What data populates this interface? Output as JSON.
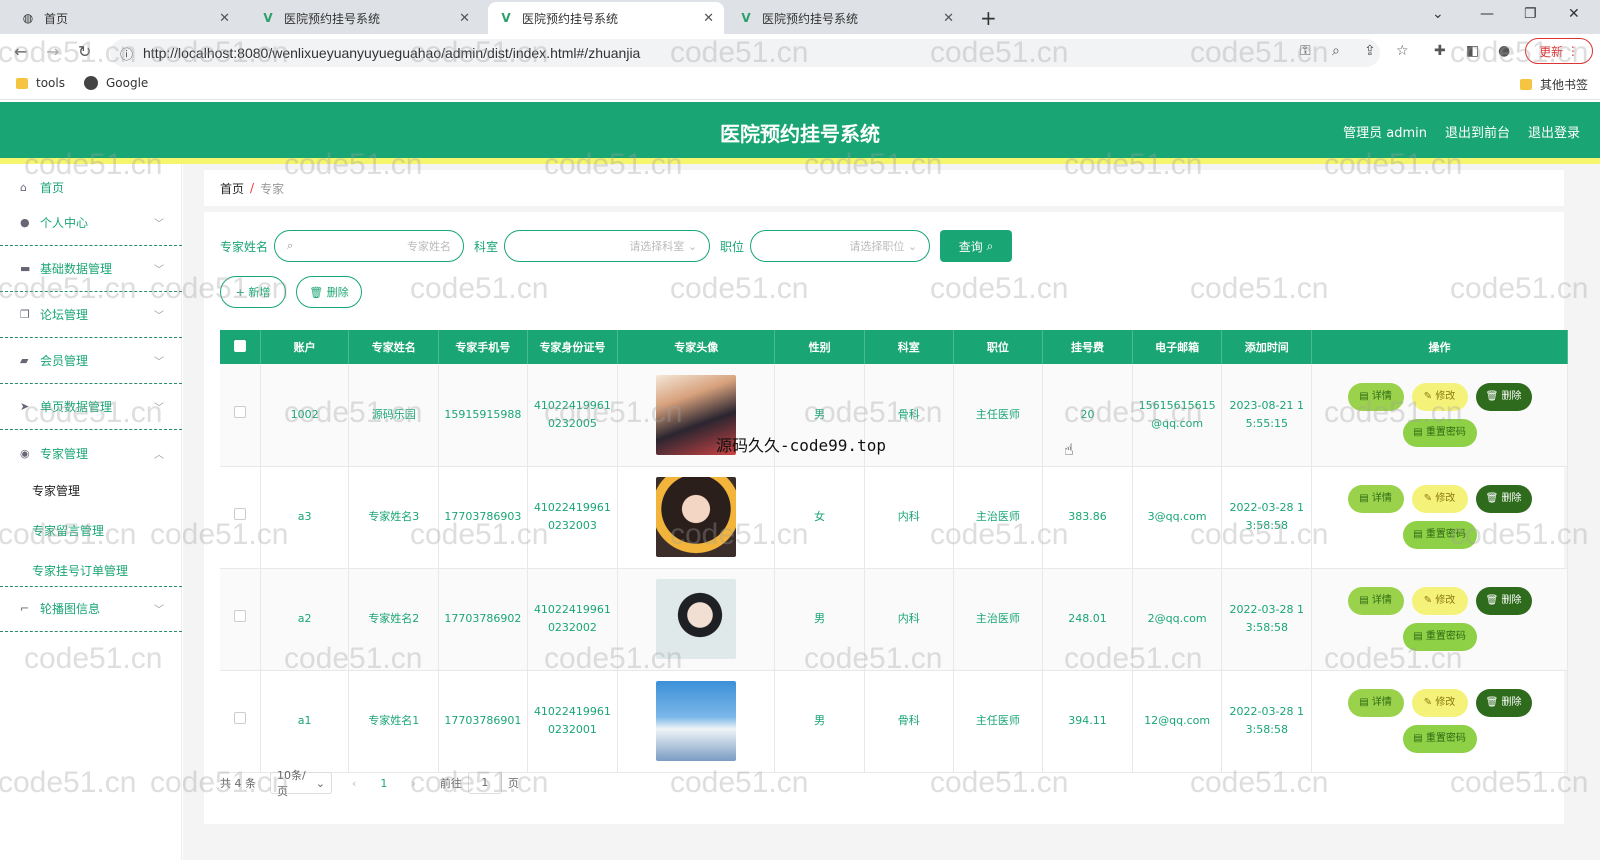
{
  "browser": {
    "tabs": [
      {
        "title": "首页",
        "icon": "globe-icon"
      },
      {
        "title": "医院预约挂号系统",
        "icon": "vue-icon"
      },
      {
        "title": "医院预约挂号系统",
        "icon": "vue-icon"
      },
      {
        "title": "医院预约挂号系统",
        "icon": "vue-icon"
      }
    ],
    "url": "http://localhost:8080/wenlixueyuanyuyueguahao/admin/dist/index.html#/zhuanjia",
    "update_label": "更新",
    "bookmarks": [
      "tools",
      "Google"
    ],
    "other_bookmarks": "其他书签"
  },
  "header": {
    "title": "医院预约挂号系统",
    "admin": "管理员 admin",
    "back_front": "退出到前台",
    "logout": "退出登录"
  },
  "sidebar": {
    "items": [
      {
        "label": "首页",
        "icon": "home-icon"
      },
      {
        "label": "个人中心",
        "icon": "user-icon"
      },
      {
        "label": "基础数据管理",
        "icon": "monitor-icon"
      },
      {
        "label": "论坛管理",
        "icon": "copy-icon"
      },
      {
        "label": "会员管理",
        "icon": "briefcase-icon"
      },
      {
        "label": "单页数据管理",
        "icon": "send-icon"
      },
      {
        "label": "专家管理",
        "icon": "location-icon"
      },
      {
        "label": "轮播图信息",
        "icon": "crop-icon"
      }
    ],
    "sub_items": [
      "专家管理",
      "专家留言管理",
      "专家挂号订单管理"
    ]
  },
  "breadcrumb": {
    "home": "首页",
    "current": "专家"
  },
  "search": {
    "name_label": "专家姓名",
    "name_placeholder": "专家姓名",
    "dept_label": "科室",
    "dept_placeholder": "请选择科室",
    "title_label": "职位",
    "title_placeholder": "请选择职位",
    "query_label": "查询"
  },
  "actions": {
    "add": "新增",
    "delete": "删除"
  },
  "table": {
    "columns": [
      "账户",
      "专家姓名",
      "专家手机号",
      "专家身份证号",
      "专家头像",
      "性别",
      "科室",
      "职位",
      "挂号费",
      "电子邮箱",
      "添加时间",
      "操作"
    ],
    "rows": [
      {
        "account": "1002",
        "name": "源码乐园",
        "phone": "15915915988",
        "idcard": "410224199610232005",
        "gender": "男",
        "dept": "骨科",
        "title": "主任医师",
        "fee": "20",
        "email": "15615615615@qq.com",
        "time": "2023-08-21 15:55:15"
      },
      {
        "account": "a3",
        "name": "专家姓名3",
        "phone": "17703786903",
        "idcard": "410224199610232003",
        "gender": "女",
        "dept": "内科",
        "title": "主治医师",
        "fee": "383.86",
        "email": "3@qq.com",
        "time": "2022-03-28 13:58:58"
      },
      {
        "account": "a2",
        "name": "专家姓名2",
        "phone": "17703786902",
        "idcard": "410224199610232002",
        "gender": "男",
        "dept": "内科",
        "title": "主治医师",
        "fee": "248.01",
        "email": "2@qq.com",
        "time": "2022-03-28 13:58:58"
      },
      {
        "account": "a1",
        "name": "专家姓名1",
        "phone": "17703786901",
        "idcard": "410224199610232001",
        "gender": "男",
        "dept": "骨科",
        "title": "主任医师",
        "fee": "394.11",
        "email": "12@qq.com",
        "time": "2022-03-28 13:58:58"
      }
    ],
    "op_labels": {
      "detail": "详情",
      "edit": "修改",
      "delete": "删除",
      "reset": "重置密码"
    }
  },
  "pager": {
    "total": "共 4 条",
    "size": "10条/页",
    "current": "1",
    "goto": "前往",
    "page_input": "1",
    "page_suffix": "页"
  },
  "overlay_text": "源码久久-code99.top",
  "watermark": "code51.cn"
}
